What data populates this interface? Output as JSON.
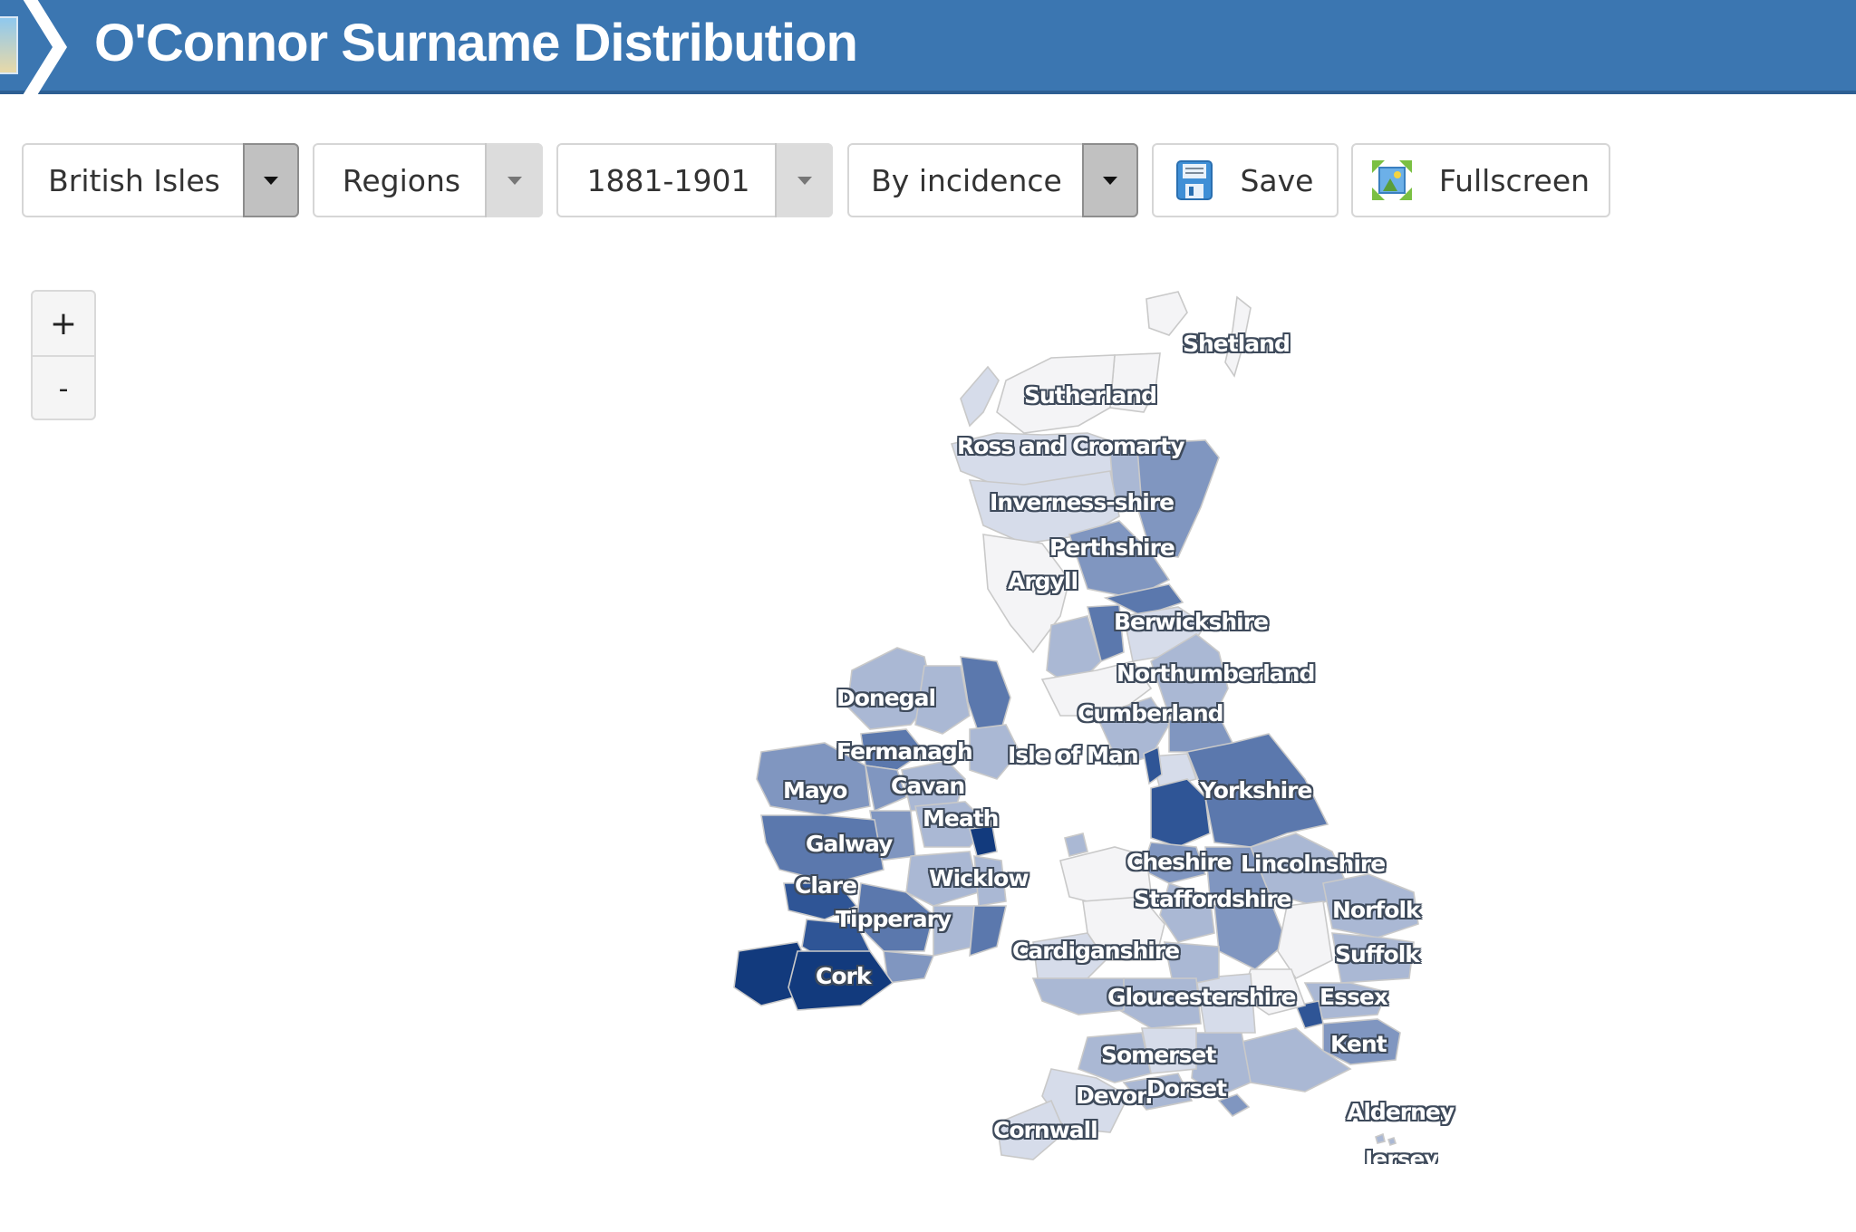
{
  "header": {
    "title": "O'Connor Surname Distribution",
    "color": "#3b76b1",
    "app_icon": "map-icon"
  },
  "toolbar": {
    "area_select": {
      "value": "British Isles",
      "icon": "chevron-down-icon"
    },
    "level_select": {
      "value": "Regions",
      "icon": "chevron-down-icon"
    },
    "period_select": {
      "value": "1881-1901",
      "icon": "chevron-down-icon"
    },
    "mode_select": {
      "value": "By incidence",
      "icon": "chevron-down-icon"
    },
    "save_button": {
      "label": "Save",
      "icon": "floppy-disk-icon"
    },
    "fullscreen_button": {
      "label": "Fullscreen",
      "icon": "fullscreen-icon"
    }
  },
  "map_controls": {
    "zoom_in": "+",
    "zoom_out": "-"
  },
  "map": {
    "color_scale": [
      "#f4f4f6",
      "#d6dcea",
      "#aab8d4",
      "#8096c0",
      "#5b78ad",
      "#2f5596",
      "#123a7d"
    ],
    "labels": {
      "shetland": "Shetland",
      "sutherland": "Sutherland",
      "ross_and_cromarty": "Ross and Cromarty",
      "inverness_shire": "Inverness-shire",
      "perthshire": "Perthshire",
      "argyll": "Argyll",
      "berwickshire": "Berwickshire",
      "northumberland": "Northumberland",
      "cumberland": "Cumberland",
      "isle_of_man": "Isle of Man",
      "yorkshire": "Yorkshire",
      "donegal": "Donegal",
      "fermanagh": "Fermanagh",
      "mayo": "Mayo",
      "cavan": "Cavan",
      "meath": "Meath",
      "galway": "Galway",
      "clare": "Clare",
      "wicklow": "Wicklow",
      "tipperary": "Tipperary",
      "cork": "Cork",
      "cheshire": "Cheshire",
      "lincolnshire": "Lincolnshire",
      "staffordshire": "Staffordshire",
      "norfolk": "Norfolk",
      "cardiganshire": "Cardiganshire",
      "suffolk": "Suffolk",
      "gloucestershire": "Gloucestershire",
      "essex": "Essex",
      "kent": "Kent",
      "somerset": "Somerset",
      "devon": "Devon",
      "dorset": "Dorset",
      "cornwall": "Cornwall",
      "alderney": "Alderney",
      "jersey": "Jersey"
    }
  }
}
